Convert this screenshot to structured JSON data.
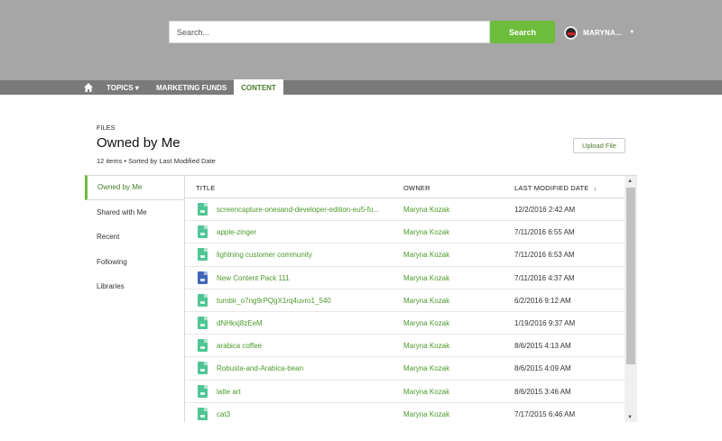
{
  "header": {
    "search_placeholder": "Search...",
    "search_button": "Search",
    "user_name": "MARYNA..."
  },
  "nav": {
    "home_icon": "home-icon",
    "topics": "TOPICS ▾",
    "marketing_funds": "MARKETING FUNDS",
    "content": "CONTENT"
  },
  "page": {
    "section_label": "FILES",
    "title": "Owned by Me",
    "subtitle": "12 items • Sorted by Last Modified Date",
    "upload_button": "Upload File"
  },
  "sidebar": {
    "items": [
      {
        "label": "Owned by Me",
        "active": true
      },
      {
        "label": "Shared with Me",
        "active": false
      },
      {
        "label": "Recent",
        "active": false
      },
      {
        "label": "Following",
        "active": false
      },
      {
        "label": "Libraries",
        "active": false
      }
    ]
  },
  "table": {
    "columns": {
      "title": "TITLE",
      "owner": "OWNER",
      "last_modified": "LAST MODIFIED DATE",
      "sort_indicator": "↓"
    },
    "rows": [
      {
        "title": "screencapture-onesand-developer-edition-eu5-fo...",
        "owner": "Maryna Kozak",
        "date": "12/2/2016 2:42 AM",
        "icon": "image-file-icon"
      },
      {
        "title": "apple-zinger",
        "owner": "Maryna Kozak",
        "date": "7/11/2016 6:55 AM",
        "icon": "image-file-icon"
      },
      {
        "title": "lightning customer community",
        "owner": "Maryna Kozak",
        "date": "7/11/2016 6:53 AM",
        "icon": "image-file-icon"
      },
      {
        "title": "New Content Pack 111",
        "owner": "Maryna Kozak",
        "date": "7/11/2016 4:37 AM",
        "icon": "content-pack-icon"
      },
      {
        "title": "tumblr_o7ng9rPQgX1rq4uvro1_540",
        "owner": "Maryna Kozak",
        "date": "6/2/2016 9:12 AM",
        "icon": "image-file-icon"
      },
      {
        "title": "dNHkxj8zEeM",
        "owner": "Maryna Kozak",
        "date": "1/19/2016 9:37 AM",
        "icon": "image-file-icon"
      },
      {
        "title": "arabica coffee",
        "owner": "Maryna Kozak",
        "date": "8/6/2015 4:13 AM",
        "icon": "image-file-icon"
      },
      {
        "title": "Robusta-and-Arabica-bean",
        "owner": "Maryna Kozak",
        "date": "8/6/2015 4:09 AM",
        "icon": "image-file-icon"
      },
      {
        "title": "latte art",
        "owner": "Maryna Kozak",
        "date": "8/6/2015 3:46 AM",
        "icon": "image-file-icon"
      },
      {
        "title": "cat3",
        "owner": "Maryna Kozak",
        "date": "7/17/2015 6:46 AM",
        "icon": "image-file-icon"
      }
    ]
  },
  "colors": {
    "header_bg": "#a6a6a6",
    "nav_bg": "#7a7a7a",
    "accent_green": "#6dbd3c",
    "link_green": "#4a9a2a",
    "file_icon_green": "#4fc596",
    "file_icon_blue": "#3e67b9"
  }
}
